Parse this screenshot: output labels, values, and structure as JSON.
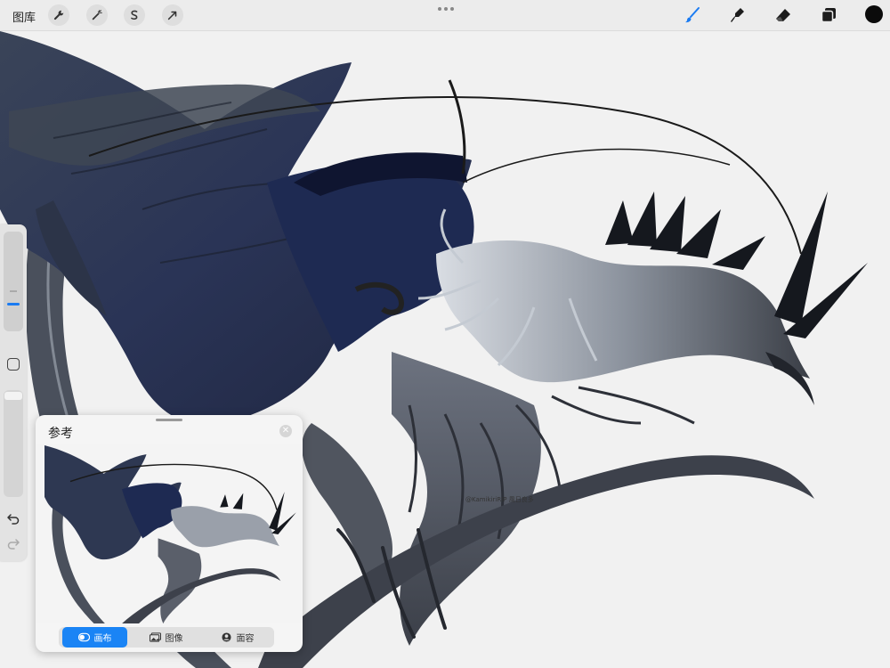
{
  "toolbar": {
    "gallery_label": "图库",
    "tools": [
      {
        "name": "actions",
        "icon": "wrench-icon"
      },
      {
        "name": "adjustments",
        "icon": "magic-wand-icon"
      },
      {
        "name": "selection",
        "icon": "selection-s-icon"
      },
      {
        "name": "transform",
        "icon": "arrow-cursor-icon"
      }
    ],
    "right_tools": [
      {
        "name": "brush",
        "icon": "brush-icon",
        "active": true
      },
      {
        "name": "smudge",
        "icon": "smudge-finger-icon"
      },
      {
        "name": "eraser",
        "icon": "eraser-icon"
      },
      {
        "name": "layers",
        "icon": "layers-icon"
      }
    ],
    "current_color": "#0b0b0b",
    "accent_color": "#1a7bf2"
  },
  "sidebar": {
    "brush_size": 0.32,
    "brush_opacity": 0.98,
    "modify_icon": "square-icon",
    "undo_icon": "undo-arrow-icon",
    "redo_icon": "redo-arrow-icon"
  },
  "reference": {
    "title": "参考",
    "close_icon": "close-x-icon",
    "tabs": [
      {
        "label": "画布",
        "icon": "toggle-icon",
        "active": true
      },
      {
        "label": "图像",
        "icon": "image-icon",
        "active": false
      },
      {
        "label": "面容",
        "icon": "face-icon",
        "active": false
      }
    ]
  },
  "canvas": {
    "watermark": "@KamikiriRIP  風日良多"
  }
}
